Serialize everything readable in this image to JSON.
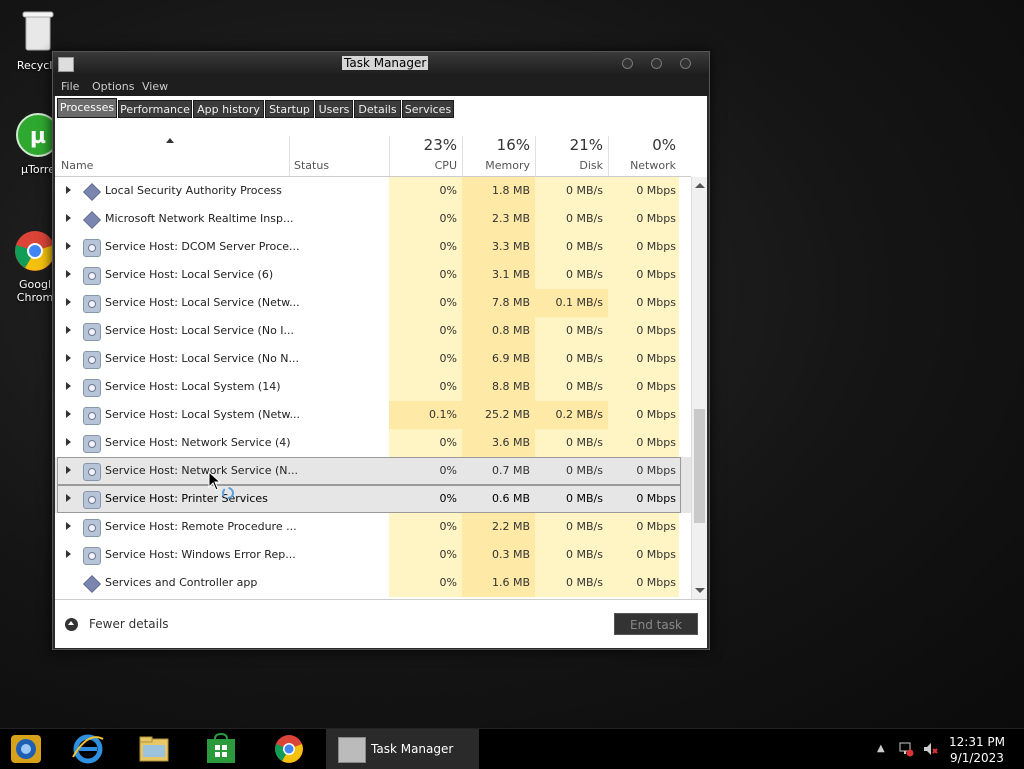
{
  "desktop": {
    "icons": [
      {
        "label": "Recycle"
      },
      {
        "label": "µTorre"
      },
      {
        "label": "Googl\nChrom"
      }
    ]
  },
  "window": {
    "title": "Task Manager",
    "menu": [
      "File",
      "Options",
      "View"
    ],
    "tabs": [
      "Processes",
      "Performance",
      "App history",
      "Startup",
      "Users",
      "Details",
      "Services"
    ],
    "active_tab": "Processes"
  },
  "columns": {
    "name": "Name",
    "status": "Status",
    "cpu": {
      "pct": "23%",
      "label": "CPU"
    },
    "memory": {
      "pct": "16%",
      "label": "Memory"
    },
    "disk": {
      "pct": "21%",
      "label": "Disk"
    },
    "network": {
      "pct": "0%",
      "label": "Network"
    }
  },
  "processes": [
    {
      "name": "Local Security Authority Process",
      "icon": "diamond-icon",
      "expandable": true,
      "cpu": "0%",
      "memory": "1.8 MB",
      "disk": "0 MB/s",
      "network": "0 Mbps"
    },
    {
      "name": "Microsoft Network Realtime Insp...",
      "icon": "diamond-icon",
      "expandable": true,
      "cpu": "0%",
      "memory": "2.3 MB",
      "disk": "0 MB/s",
      "network": "0 Mbps"
    },
    {
      "name": "Service Host: DCOM Server Proce...",
      "icon": "gear-icon",
      "expandable": true,
      "cpu": "0%",
      "memory": "3.3 MB",
      "disk": "0 MB/s",
      "network": "0 Mbps"
    },
    {
      "name": "Service Host: Local Service (6)",
      "icon": "gear-icon",
      "expandable": true,
      "cpu": "0%",
      "memory": "3.1 MB",
      "disk": "0 MB/s",
      "network": "0 Mbps"
    },
    {
      "name": "Service Host: Local Service (Netw...",
      "icon": "gear-icon",
      "expandable": true,
      "cpu": "0%",
      "memory": "7.8 MB",
      "disk": "0.1 MB/s",
      "network": "0 Mbps"
    },
    {
      "name": "Service Host: Local Service (No I...",
      "icon": "gear-icon",
      "expandable": true,
      "cpu": "0%",
      "memory": "0.8 MB",
      "disk": "0 MB/s",
      "network": "0 Mbps"
    },
    {
      "name": "Service Host: Local Service (No N...",
      "icon": "gear-icon",
      "expandable": true,
      "cpu": "0%",
      "memory": "6.9 MB",
      "disk": "0 MB/s",
      "network": "0 Mbps"
    },
    {
      "name": "Service Host: Local System (14)",
      "icon": "gear-icon",
      "expandable": true,
      "cpu": "0%",
      "memory": "8.8 MB",
      "disk": "0 MB/s",
      "network": "0 Mbps"
    },
    {
      "name": "Service Host: Local System (Netw...",
      "icon": "gear-icon",
      "expandable": true,
      "cpu": "0.1%",
      "memory": "25.2 MB",
      "disk": "0.2 MB/s",
      "network": "0 Mbps"
    },
    {
      "name": "Service Host: Network Service (4)",
      "icon": "gear-icon",
      "expandable": true,
      "cpu": "0%",
      "memory": "3.6 MB",
      "disk": "0 MB/s",
      "network": "0 Mbps"
    },
    {
      "name": "Service Host: Network Service (N...",
      "icon": "gear-icon",
      "expandable": true,
      "cpu": "0%",
      "memory": "0.7 MB",
      "disk": "0 MB/s",
      "network": "0 Mbps",
      "state": "hover"
    },
    {
      "name": "Service Host: Printer Services",
      "icon": "gear-icon",
      "expandable": true,
      "cpu": "0%",
      "memory": "0.6 MB",
      "disk": "0 MB/s",
      "network": "0 Mbps",
      "state": "selected"
    },
    {
      "name": "Service Host: Remote Procedure ...",
      "icon": "gear-icon",
      "expandable": true,
      "cpu": "0%",
      "memory": "2.2 MB",
      "disk": "0 MB/s",
      "network": "0 Mbps"
    },
    {
      "name": "Service Host: Windows Error Rep...",
      "icon": "gear-icon",
      "expandable": true,
      "cpu": "0%",
      "memory": "0.3 MB",
      "disk": "0 MB/s",
      "network": "0 Mbps"
    },
    {
      "name": "Services and Controller app",
      "icon": "diamond-icon",
      "expandable": false,
      "cpu": "0%",
      "memory": "1.6 MB",
      "disk": "0 MB/s",
      "network": "0 Mbps"
    }
  ],
  "footer": {
    "fewer_details": "Fewer details",
    "end_task": "End task"
  },
  "taskbar": {
    "active_app": "Task Manager",
    "time": "12:31 PM",
    "date": "9/1/2023"
  },
  "colors": {
    "heat_light": "#fff4c4",
    "heat_mid": "#ffe9a6",
    "window_chrome": "#2a2a2a"
  }
}
